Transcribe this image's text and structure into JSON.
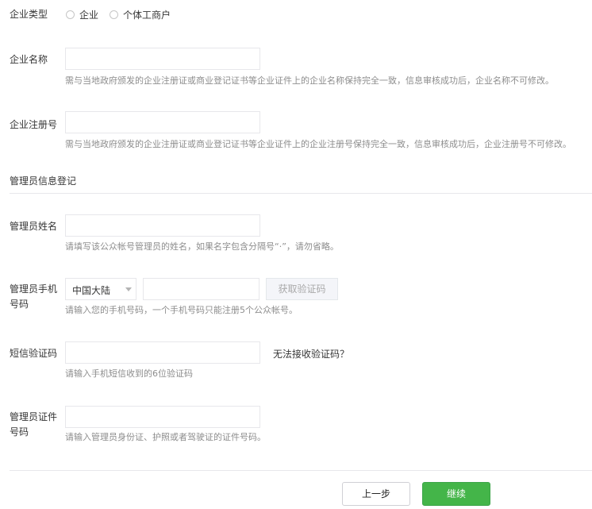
{
  "company_type": {
    "label": "企业类型",
    "options": [
      "企业",
      "个体工商户"
    ]
  },
  "company_name": {
    "label": "企业名称",
    "value": "",
    "hint": "需与当地政府颁发的企业注册证或商业登记证书等企业证件上的企业名称保持完全一致，信息审核成功后，企业名称不可修改。"
  },
  "registration_no": {
    "label": "企业注册号",
    "value": "",
    "hint": "需与当地政府颁发的企业注册证或商业登记证书等企业证件上的企业注册号保持完全一致，信息审核成功后，企业注册号不可修改。"
  },
  "admin_section": {
    "title": "管理员信息登记"
  },
  "admin_name": {
    "label": "管理员姓名",
    "value": "",
    "hint": "请填写该公众帐号管理员的姓名，如果名字包含分隔号“·”，请勿省略。"
  },
  "admin_phone": {
    "label_line1": "管理员手机",
    "label_line2": "号码",
    "region": "中国大陆",
    "value": "",
    "get_code_button": "获取验证码",
    "hint": "请输入您的手机号码，一个手机号码只能注册5个公众帐号。"
  },
  "sms_code": {
    "label": "短信验证码",
    "value": "",
    "no_code_link": "无法接收验证码？",
    "hint": "请输入手机短信收到的6位验证码"
  },
  "admin_id": {
    "label_line1": "管理员证件",
    "label_line2": "号码",
    "value": "",
    "hint": "请输入管理员身份证、护照或者驾驶证的证件号码。"
  },
  "actions": {
    "prev": "上一步",
    "next": "继续"
  }
}
